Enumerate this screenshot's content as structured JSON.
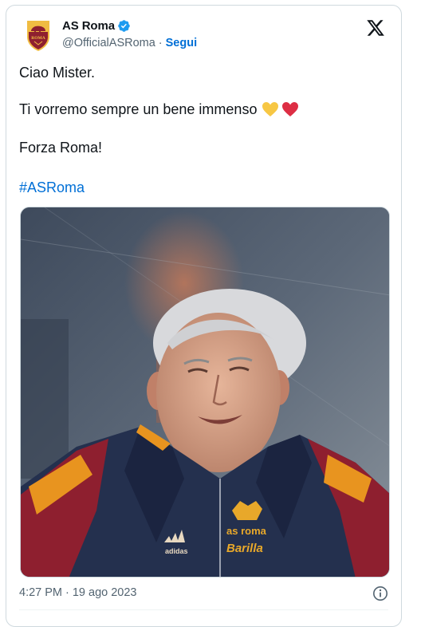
{
  "account": {
    "name": "AS Roma",
    "handle": "@OfficialASRoma",
    "separator": "·",
    "follow_label": "Segui",
    "verified": true,
    "avatar_icon": "as-roma-crest-icon",
    "avatar_text": "ROMA"
  },
  "tweet": {
    "line1": "Ciao Mister.",
    "line2": "Ti vorremo sempre un bene immenso",
    "line2_emojis": [
      "yellow-heart-icon",
      "red-heart-icon"
    ],
    "line3": "Forza Roma!",
    "hashtag": "#ASRoma"
  },
  "media": {
    "jacket_logo": "as roma",
    "jacket_sponsor": "Barilla",
    "jacket_brand": "adidas"
  },
  "meta": {
    "time": "4:27 PM",
    "separator": "·",
    "date": "19 ago 2023"
  },
  "icons": {
    "platform": "x-logo-icon",
    "info": "info-icon"
  },
  "colors": {
    "link": "#006fd6",
    "secondary_text": "#536471",
    "verified": "#1d9bf0",
    "roma_red": "#8e1f2f",
    "roma_gold": "#f0bc42"
  }
}
